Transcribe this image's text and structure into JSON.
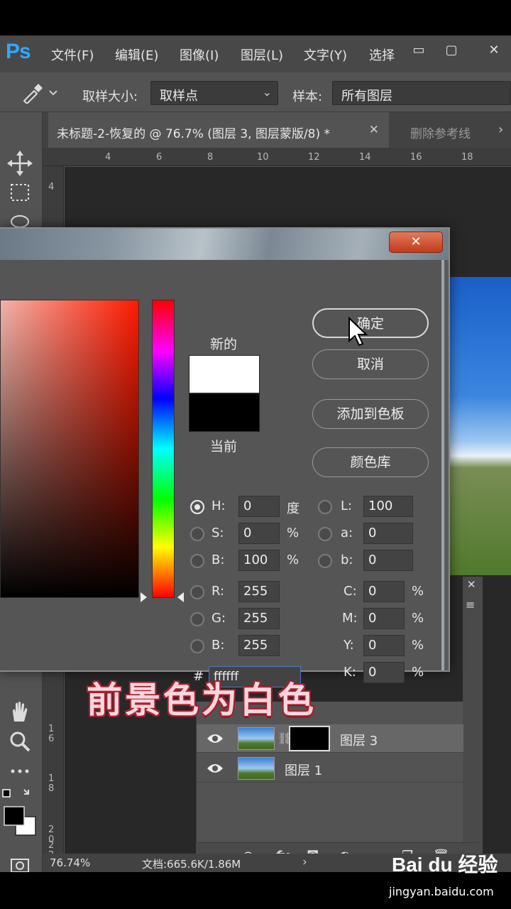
{
  "app": {
    "logo": "Ps"
  },
  "menu": [
    "文件(F)",
    "编辑(E)",
    "图像(I)",
    "图层(L)",
    "文字(Y)",
    "选择"
  ],
  "window_controls": {
    "minimize": "▭",
    "restore": "▢",
    "close": "✕"
  },
  "options_bar": {
    "sample_size_label": "取样大小:",
    "sample_size_value": "取样点",
    "sample_label": "样本:",
    "sample_value": "所有图层"
  },
  "tabs": {
    "active": "未标题-2-恢复的 @ 76.7% (图层 3, 图层蒙版/8) *",
    "active_close": "✕",
    "second": "删除参考线",
    "more": "›"
  },
  "ruler": {
    "h": [
      "4",
      "6",
      "8",
      "10",
      "12",
      "14",
      "16",
      "18"
    ],
    "v": [
      "4",
      "1\n6",
      "1\n8",
      "2\n0",
      "2\n2"
    ]
  },
  "dialog": {
    "close": "✕",
    "new_label": "新的",
    "current_label": "当前",
    "buttons": {
      "ok": "确定",
      "cancel": "取消",
      "add_swatch": "添加到色板",
      "libraries": "颜色库"
    },
    "fields": {
      "H": {
        "label": "H:",
        "value": "0",
        "unit": "度"
      },
      "S": {
        "label": "S:",
        "value": "0",
        "unit": "%"
      },
      "Bv": {
        "label": "B:",
        "value": "100",
        "unit": "%"
      },
      "R": {
        "label": "R:",
        "value": "255"
      },
      "G": {
        "label": "G:",
        "value": "255"
      },
      "B": {
        "label": "B:",
        "value": "255"
      },
      "L": {
        "label": "L:",
        "value": "100"
      },
      "a": {
        "label": "a:",
        "value": "0"
      },
      "b": {
        "label": "b:",
        "value": "0"
      },
      "C": {
        "label": "C:",
        "value": "0",
        "unit": "%"
      },
      "M": {
        "label": "M:",
        "value": "0",
        "unit": "%"
      },
      "Y": {
        "label": "Y:",
        "value": "0",
        "unit": "%"
      },
      "K": {
        "label": "K:",
        "value": "0",
        "unit": "%"
      }
    },
    "hex_label": "#",
    "hex_value": "ffffff"
  },
  "layers": [
    {
      "name": "图层 3",
      "selected": true
    },
    {
      "name": "图层 1",
      "selected": false
    }
  ],
  "status": {
    "zoom": "76.74%",
    "doc": "文档:665.6K/1.86M",
    "arrow": "›"
  },
  "caption": "前景色为白色",
  "watermark": {
    "brand": "Bai du 经验",
    "url": "jingyan.baidu.com"
  },
  "colors": {
    "new_color": "#ffffff",
    "current_color": "#000000",
    "accent": "#31a8ff"
  }
}
